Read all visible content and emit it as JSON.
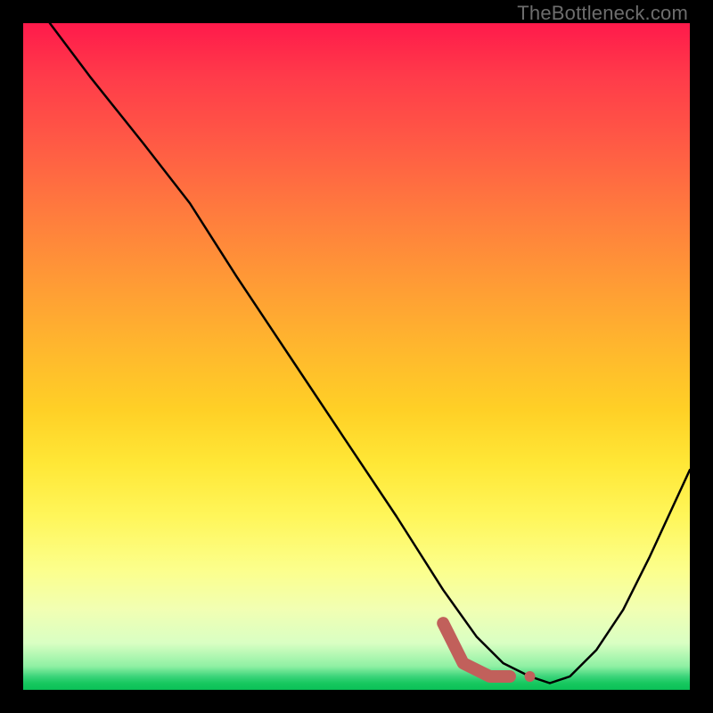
{
  "watermark": "TheBottleneck.com",
  "chart_data": {
    "type": "line",
    "title": "",
    "xlabel": "",
    "ylabel": "",
    "xlim": [
      0,
      100
    ],
    "ylim": [
      0,
      100
    ],
    "series": [
      {
        "name": "bottleneck-curve",
        "x": [
          4,
          10,
          18,
          25,
          32,
          40,
          48,
          56,
          63,
          68,
          72,
          76,
          79,
          82,
          86,
          90,
          94,
          100
        ],
        "y": [
          100,
          92,
          82,
          73,
          62,
          50,
          38,
          26,
          15,
          8,
          4,
          2,
          1,
          2,
          6,
          12,
          20,
          33
        ]
      }
    ],
    "markers": {
      "name": "highlight-segment",
      "x": [
        63,
        66,
        70,
        73,
        76
      ],
      "y": [
        10,
        4,
        2,
        2,
        2
      ]
    },
    "gradient_stops": [
      {
        "pos": 0.0,
        "color": "#ff1a4b"
      },
      {
        "pos": 0.5,
        "color": "#ffd026"
      },
      {
        "pos": 0.85,
        "color": "#fcff8c"
      },
      {
        "pos": 1.0,
        "color": "#0bc157"
      }
    ]
  }
}
